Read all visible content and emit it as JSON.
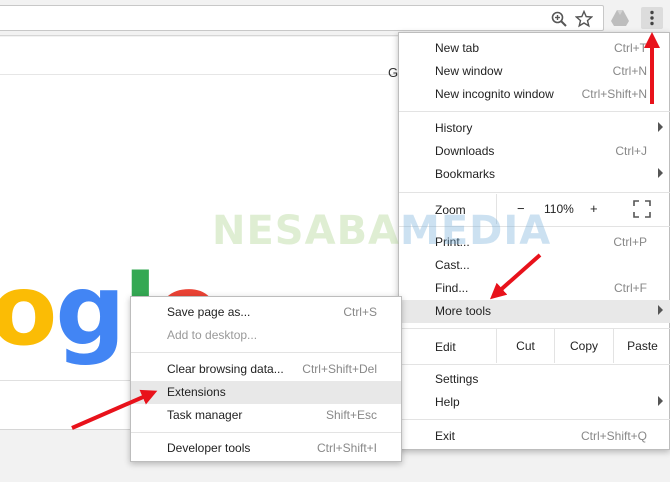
{
  "toolbar": {
    "zoom_icon": "zoom-in-icon",
    "star_icon": "star-icon",
    "extension_icon": "drive-icon",
    "menu_icon": "three-dots-vertical-icon"
  },
  "page": {
    "g_label": "G",
    "logo_text": [
      "o",
      "g",
      "l",
      "e"
    ],
    "logo_colors": [
      "#fbbc05",
      "#4285f4",
      "#34a853",
      "#ea4335"
    ]
  },
  "watermark": {
    "part1": "NESABA",
    "part2": "MEDIA"
  },
  "menu": {
    "new_tab": {
      "label": "New tab",
      "shortcut": "Ctrl+T"
    },
    "new_window": {
      "label": "New window",
      "shortcut": "Ctrl+N"
    },
    "new_incognito": {
      "label": "New incognito window",
      "shortcut": "Ctrl+Shift+N"
    },
    "history": {
      "label": "History"
    },
    "downloads": {
      "label": "Downloads",
      "shortcut": "Ctrl+J"
    },
    "bookmarks": {
      "label": "Bookmarks"
    },
    "zoom": {
      "label": "Zoom",
      "minus": "−",
      "value": "110%",
      "plus": "+"
    },
    "print": {
      "label": "Print...",
      "shortcut": "Ctrl+P"
    },
    "cast": {
      "label": "Cast..."
    },
    "find": {
      "label": "Find...",
      "shortcut": "Ctrl+F"
    },
    "more_tools": {
      "label": "More tools"
    },
    "edit": {
      "label": "Edit",
      "cut": "Cut",
      "copy": "Copy",
      "paste": "Paste"
    },
    "settings": {
      "label": "Settings"
    },
    "help": {
      "label": "Help"
    },
    "exit": {
      "label": "Exit",
      "shortcut": "Ctrl+Shift+Q"
    }
  },
  "submenu": {
    "save_page": {
      "label": "Save page as...",
      "shortcut": "Ctrl+S"
    },
    "add_desktop": {
      "label": "Add to desktop..."
    },
    "clear_data": {
      "label": "Clear browsing data...",
      "shortcut": "Ctrl+Shift+Del"
    },
    "extensions": {
      "label": "Extensions"
    },
    "task_manager": {
      "label": "Task manager",
      "shortcut": "Shift+Esc"
    },
    "dev_tools": {
      "label": "Developer tools",
      "shortcut": "Ctrl+Shift+I"
    }
  },
  "colors": {
    "arrow": "#e8121b",
    "highlight": "#e8e8e8"
  }
}
